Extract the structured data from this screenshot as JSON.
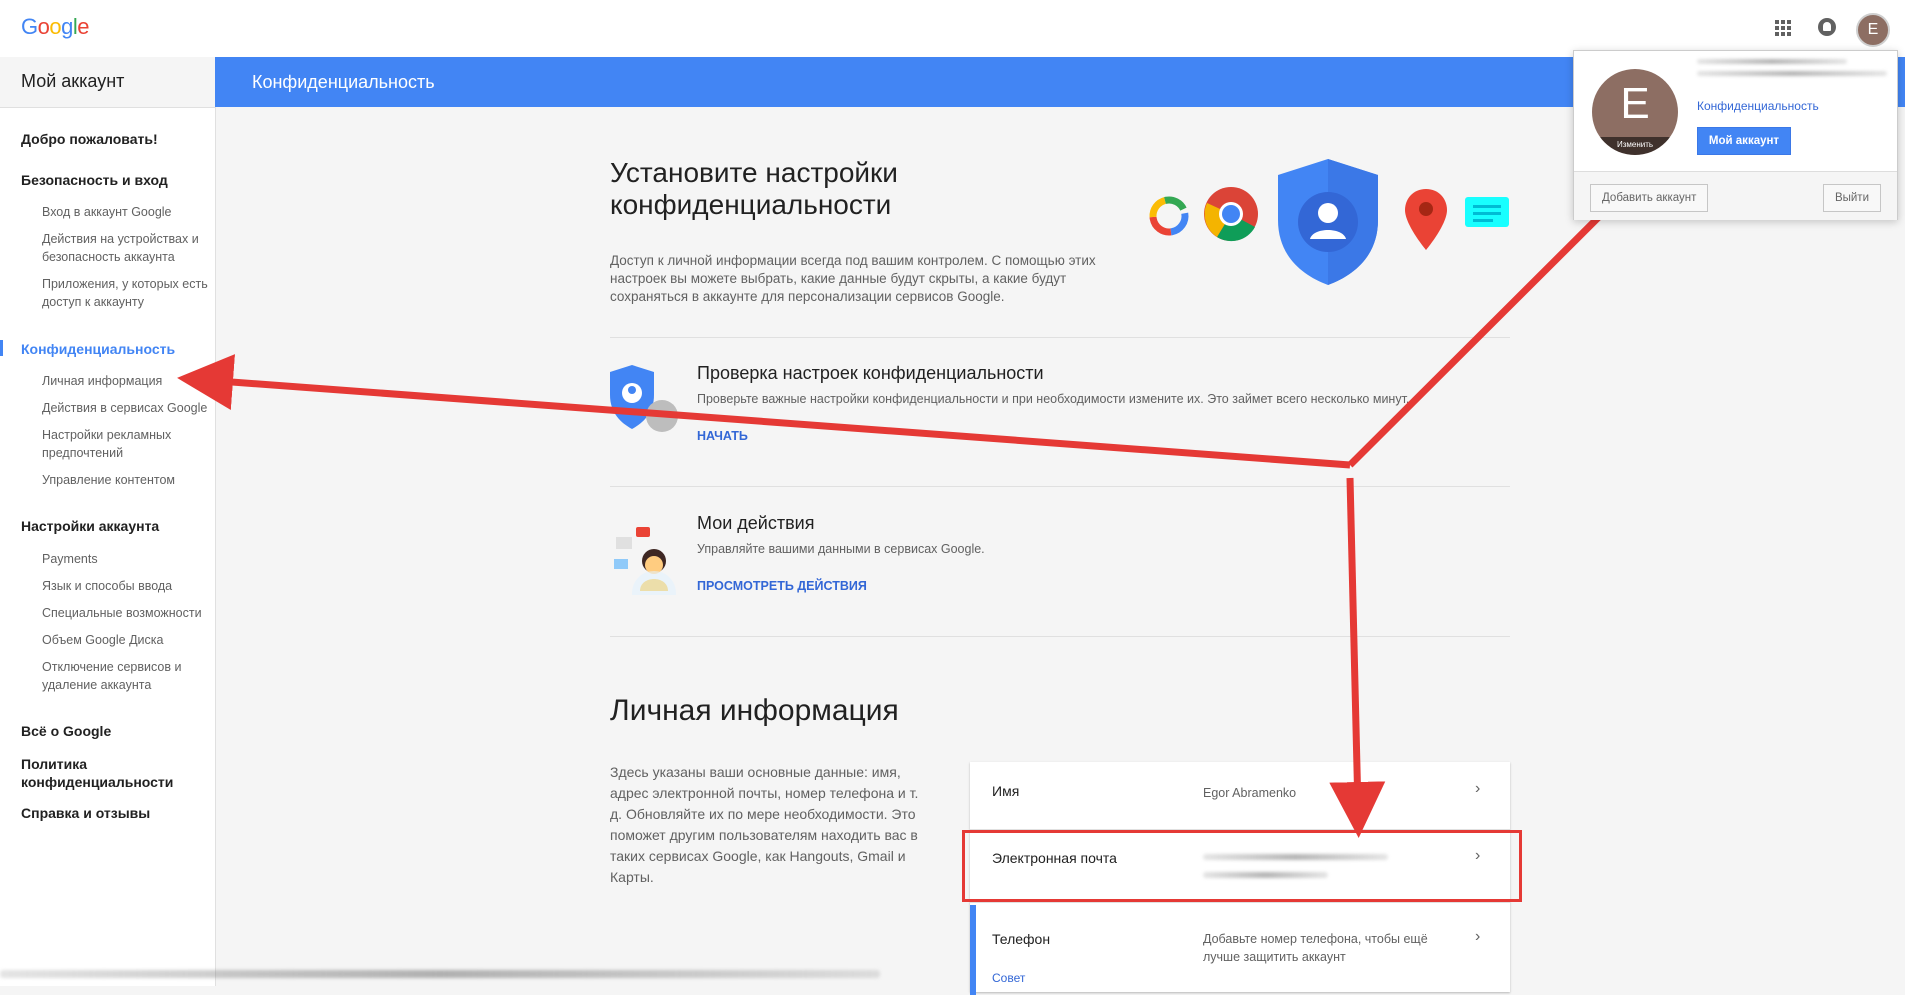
{
  "topbar": {
    "logo": "Google",
    "avatar_letter": "E"
  },
  "sidebar": {
    "title": "Мой аккаунт",
    "sections": [
      {
        "label": "Добро пожаловать!"
      },
      {
        "label": "Безопасность и вход",
        "items": [
          "Вход в аккаунт Google",
          "Действия на устройствах и безопасность аккаунта",
          "Приложения, у которых есть доступ к аккаунту"
        ]
      },
      {
        "label": "Конфиденциальность",
        "active": true,
        "items": [
          "Личная информация",
          "Действия в сервисах Google",
          "Настройки рекламных предпочтений",
          "Управление контентом"
        ]
      },
      {
        "label": "Настройки аккаунта",
        "items": [
          "Payments",
          "Язык и способы ввода",
          "Специальные возможности",
          "Объем Google Диска",
          "Отключение сервисов и удаление аккаунта"
        ]
      },
      {
        "label": "Всё о Google"
      },
      {
        "label": "Политика конфиденциальности"
      },
      {
        "label": "Справка и отзывы"
      }
    ]
  },
  "header": {
    "title": "Конфиденциальность"
  },
  "intro": {
    "title": "Установите настройки конфиденциальности",
    "text": "Доступ к личной информации всегда под вашим контролем. С помощью этих настроек вы можете выбрать, какие данные будут скрыты, а какие будут сохраняться в аккаунте для персонализации сервисов Google."
  },
  "cards": [
    {
      "title": "Проверка настроек конфиденциальности",
      "desc": "Проверьте важные настройки конфиденциальности и при необходимости измените их. Это займет всего несколько минут.",
      "link": "НАЧАТЬ"
    },
    {
      "title": "Мои действия",
      "desc": "Управляйте вашими данными в сервисах Google.",
      "link": "ПРОСМОТРЕТЬ ДЕЙСТВИЯ"
    }
  ],
  "personal": {
    "title": "Личная информация",
    "desc": "Здесь указаны ваши основные данные: имя, адрес электронной почты, номер телефона и т. д. Обновляйте их по мере необходимости. Это поможет другим пользователям находить вас в таких сервисах Google, как Hangouts, Gmail и Карты.",
    "rows": [
      {
        "label": "Имя",
        "value": "Egor Abramenko"
      },
      {
        "label": "Электронная почта",
        "value": ""
      },
      {
        "label": "Телефон",
        "value": "Добавьте номер телефона, чтобы ещё лучше защитить аккаунт",
        "tip": "Совет"
      }
    ]
  },
  "popup": {
    "avatar_letter": "E",
    "change_label": "Изменить",
    "privacy_link": "Конфиденциальность",
    "my_account": "Мой аккаунт",
    "add_account": "Добавить аккаунт",
    "logout": "Выйти"
  },
  "colors": {
    "brand_blue": "#4285f4",
    "link_blue": "#3367d6",
    "annotation_red": "#e53935",
    "avatar": "#8d6e63"
  }
}
